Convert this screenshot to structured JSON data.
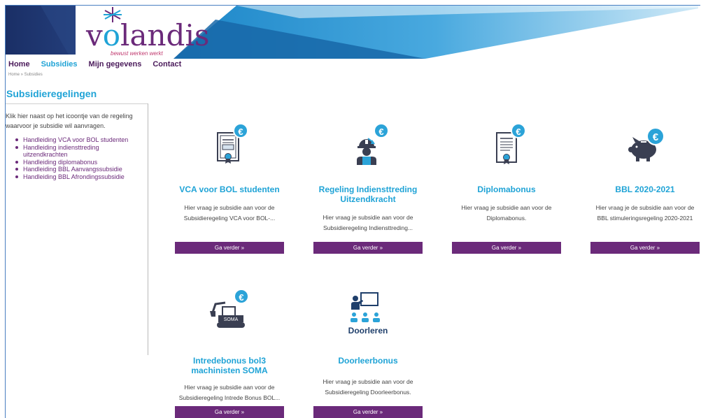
{
  "brand": {
    "logo_part1": "v",
    "logo_o": "o",
    "logo_part2": "landis",
    "tagline": "bewust werken werkt",
    "colors": {
      "purple": "#6b2a7a",
      "blue": "#1fa3d6"
    }
  },
  "nav": [
    {
      "label": "Home",
      "active": false
    },
    {
      "label": "Subsidies",
      "active": true
    },
    {
      "label": "Mijn gegevens",
      "active": false
    },
    {
      "label": "Contact",
      "active": false
    }
  ],
  "breadcrumb": "Home  »  Subsidies",
  "sidebar": {
    "title": "Subsidieregelingen",
    "intro": "Klik hier naast op het icoontje van de regeling waarvoor je subsidie wil aanvragen.",
    "links": [
      "Handleiding VCA voor BOL studenten",
      "Handleiding indiensttreding uitzendkrachten",
      "Handleiding diplomabonus",
      "Handleiding BBL Aanvangssubsidie",
      "Handleiding BBL Afrondingssubsidie"
    ]
  },
  "cards": [
    {
      "icon": "certificate-euro-icon",
      "title": "VCA voor BOL studenten",
      "desc": "Hier vraag je subsidie aan voor de Subsidieregeling VCA voor BOL-...",
      "button": "Ga verder »"
    },
    {
      "icon": "worker-euro-icon",
      "title": "Regeling Indiensttreding Uitzendkracht",
      "desc": "Hier vraag je subsidie aan voor de Subsidieregeling Indiensttreding...",
      "button": "Ga verder »"
    },
    {
      "icon": "diploma-euro-icon",
      "title": "Diplomabonus",
      "desc": "Hier vraag je subsidie aan voor de Diplomabonus.",
      "button": "Ga verder »"
    },
    {
      "icon": "piggybank-euro-icon",
      "title": "BBL 2020-2021",
      "desc": "Hier vraag je de subsidie aan voor de BBL stimuleringsregeling 2020-2021",
      "button": "Ga verder »"
    },
    {
      "icon": "excavator-euro-icon",
      "title": "Intredebonus bol3 machinisten SOMA",
      "desc": "Hier vraag je subsidie aan voor de Subsidieregeling Intrede Bonus BOL...",
      "button": "Ga verder »",
      "icon_label": "SOMA"
    },
    {
      "icon": "teacher-class-icon",
      "title": "Doorleerbonus",
      "desc": "Hier vraag je subsidie aan voor de Subsidieregeling Doorleerbonus.",
      "button": "Ga verder »",
      "icon_label": "Doorleren"
    }
  ],
  "euro_symbol": "€"
}
